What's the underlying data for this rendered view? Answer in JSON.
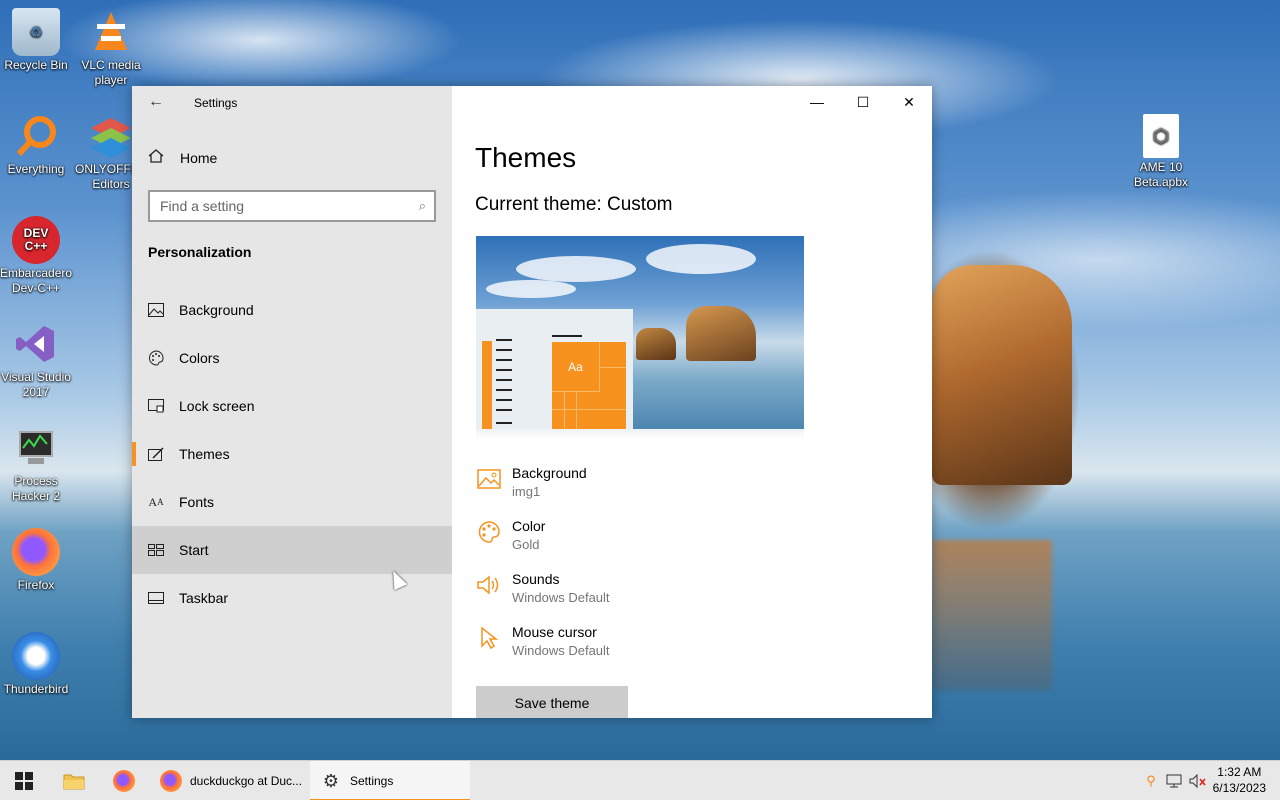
{
  "desktop": {
    "icons": [
      {
        "label": "Recycle Bin",
        "icon": "recycle-bin-icon"
      },
      {
        "label": "VLC media player",
        "icon": "vlc-icon"
      },
      {
        "label": "Everything",
        "icon": "everything-search-icon"
      },
      {
        "label": "ONLYOFFICE Editors",
        "icon": "onlyoffice-icon"
      },
      {
        "label": "Embarcadero Dev-C++",
        "icon": "devcpp-icon",
        "glyph": "DEV C++"
      },
      {
        "label": "Visual Studio 2017",
        "icon": "visual-studio-icon"
      },
      {
        "label": "Process Hacker 2",
        "icon": "process-hacker-icon"
      },
      {
        "label": "Firefox",
        "icon": "firefox-icon"
      },
      {
        "label": "Thunderbird",
        "icon": "thunderbird-icon"
      },
      {
        "label": "AME 10 Beta.apbx",
        "icon": "apbx-file-icon"
      }
    ]
  },
  "window": {
    "title": "Settings",
    "sidebar": {
      "home_label": "Home",
      "search_placeholder": "Find a setting",
      "section_heading": "Personalization",
      "items": [
        {
          "label": "Background",
          "icon": "picture-icon",
          "selected": false
        },
        {
          "label": "Colors",
          "icon": "palette-icon",
          "selected": false
        },
        {
          "label": "Lock screen",
          "icon": "lock-screen-icon",
          "selected": false
        },
        {
          "label": "Themes",
          "icon": "themes-icon",
          "selected": true
        },
        {
          "label": "Fonts",
          "icon": "fonts-icon",
          "selected": false
        },
        {
          "label": "Start",
          "icon": "start-icon",
          "selected": false
        },
        {
          "label": "Taskbar",
          "icon": "taskbar-icon",
          "selected": false
        }
      ]
    },
    "main": {
      "page_title": "Themes",
      "current_theme": "Current theme: Custom",
      "preview_tile_text": "Aa",
      "properties": [
        {
          "name": "Background",
          "value": "img1",
          "icon": "picture-icon"
        },
        {
          "name": "Color",
          "value": "Gold",
          "icon": "palette-icon"
        },
        {
          "name": "Sounds",
          "value": "Windows Default",
          "icon": "speaker-icon"
        },
        {
          "name": "Mouse cursor",
          "value": "Windows Default",
          "icon": "cursor-icon"
        }
      ],
      "save_button": "Save theme"
    }
  },
  "taskbar": {
    "apps": [
      {
        "label": "duckduckgo at Duc...",
        "icon": "firefox-icon",
        "active": false
      },
      {
        "label": "Settings",
        "icon": "gear-icon",
        "active": true
      }
    ],
    "clock": {
      "time": "1:32 AM",
      "date": "6/13/2023"
    }
  },
  "colors": {
    "accent": "#f7921e",
    "sidebar_bg": "#e6e6e6",
    "taskbar_bg": "#e8e8e8"
  }
}
